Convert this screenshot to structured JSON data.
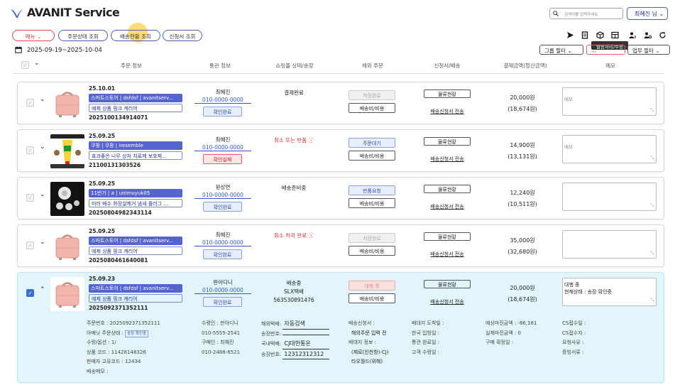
{
  "header": {
    "title": "AVANIT Service",
    "search_placeholder": "검색어를 입력하세요.",
    "user_label": "최혜진 님 ⌄"
  },
  "nav": {
    "menu": "메뉴 ⌄",
    "tabs": [
      "주문상태 조회",
      "배송현황 조회",
      "신청서 조회"
    ]
  },
  "toolbar": {
    "icons": [
      "send-icon",
      "document-icon",
      "package-icon",
      "table-icon",
      "user-sort-icon",
      "user-settings-icon",
      "refresh-icon"
    ],
    "tooltip": "발송처리/수정"
  },
  "filters": {
    "date_range": "2025-09-19~2025-10-04",
    "group_filter": "그룹 필터 ⌄",
    "hidden_filter": "…",
    "work_filter": "업무 필터 ⌄"
  },
  "columns": [
    "주문 정보",
    "통관 정보",
    "쇼핑몰 상태/송장",
    "해외 주문",
    "신청서/배송",
    "결제금액(정산금액)",
    "메모"
  ],
  "orders": [
    {
      "date": "25.10.01",
      "shop": "스마트스토어 | dsfdsf | avanitserv...",
      "product": "예제 상품 핑크 캐리어",
      "order_no": "2025100134914071",
      "name": "최혜진",
      "phone": "010-0000-0000",
      "customs_btn": "확인완료",
      "mall_status": "결제완료",
      "overseas_btn": "저장완료",
      "fee_btn": "배송비/비용",
      "logistics_btn": "물류현황",
      "apply_link": "배송신청서 전송",
      "amount": "20,000원",
      "settle": "(18,674원)",
      "memo": "메모"
    },
    {
      "date": "25.09.25",
      "shop": "쿠팡 | 쿠팡 | iresemble",
      "product": "효과좋은 나무 상처 치료제 보호제...",
      "order_no": "21100131303526",
      "name": "최혜진",
      "phone": "010-0000-0000",
      "customs_btn": "확인실패",
      "mall_status": "취소 또는 반품 ⓘ",
      "overseas_btn": "주문대기",
      "fee_btn": "배송비/비용",
      "logistics_btn": "물류현황",
      "apply_link": "배송신청서 전송",
      "amount": "14,900원",
      "settle": "(13,131원)",
      "memo": "메모"
    },
    {
      "date": "25.09.25",
      "shop": "11번가 | a | unimuyuk05",
      "product": "미러 배수 화장실제거 냄새 플러그 ...",
      "order_no": "20250804982343114",
      "name": "원상연",
      "phone": "010-0000-0000",
      "customs_btn": "확인완료",
      "mall_status": "배송준비중",
      "overseas_btn": "반품요청",
      "fee_btn": "배송비/비용",
      "logistics_btn": "물류현황",
      "apply_link": "배송신청서 전송",
      "amount": "12,240원",
      "settle": "(10,511원)",
      "memo": ""
    },
    {
      "date": "25.09.25",
      "shop": "스마트스토어 | dsfdsf | avanitserv...",
      "product": "예제 상품 핑크 캐리어",
      "order_no": "2025080461640081",
      "name": "최혜진",
      "phone": "010-0000-0000",
      "customs_btn": "확인완료",
      "mall_status": "취소 처리 완료 ⓘ",
      "overseas_btn": "저장완료",
      "fee_btn": "배송비/비용",
      "logistics_btn": "물류현황",
      "apply_link": "배송신청서 전송",
      "amount": "35,000원",
      "settle": "(32,680원)",
      "memo": ""
    },
    {
      "date": "25.09.23",
      "shop": "스마트스토어 | dsfdsf | avanitserv...",
      "product": "예제 상품 핑크 캐리어",
      "order_no": "2025092371352111",
      "name": "판아디니",
      "phone": "010-0000-0000",
      "customs_btn": "확인완료",
      "mall_status": "배송중",
      "mall_carrier": "SLX택배",
      "mall_tracking": "563530891476",
      "overseas_btn": "대행 중",
      "fee_btn": "배송비/비용",
      "logistics_btn": "물류현황",
      "apply_link": "배송신청서 전송",
      "amount": "20,000원",
      "settle": "(18,674원)",
      "memo_line1": "대행 중",
      "memo_line2": "현재상태 : 송장 확인중"
    }
  ],
  "detail": {
    "c1": [
      "주문번호 : 2025092371352111",
      "아배닛 주문상태 :",
      "수량/옵션 : 1/",
      "상품 코드 : 11428148326",
      "판매자 고유코드 : 12434",
      "배송메모 :"
    ],
    "c1_tag": "송장 확인중",
    "c2": [
      "수령인 : 판아디니",
      "010-5555-2541",
      "구매인 : 최혜진",
      "010-2488-6521"
    ],
    "c3_labels": [
      "해외택배:",
      "송장번호:",
      "국내택배:",
      "송장번호:"
    ],
    "c3_values": [
      "자동검색",
      "",
      "CJ대한통운",
      "12312312312"
    ],
    "c4": [
      "배송신청서 :",
      "해외주문 입력 전",
      "배대지 정보 :",
      "(제로(인천항)-CJ)",
      "타오월드(위해)"
    ],
    "c5": [
      "배대지 도착일 :",
      "한국 입항일 :",
      "통관 완료일 :",
      "고객 수령일 :"
    ],
    "c6": [
      "예상마진금액 : -86,181",
      "실제마진금액 : 0",
      "구매 확정일 :"
    ],
    "c7": [
      "CS접수일 :",
      "CS접수자 :",
      "요청사유 :",
      "증빙서류 :"
    ]
  },
  "colors": {
    "accent": "#5564cf",
    "selected_row": "#e1f5fb",
    "danger": "#e03535",
    "highlight": "#facd3c"
  }
}
